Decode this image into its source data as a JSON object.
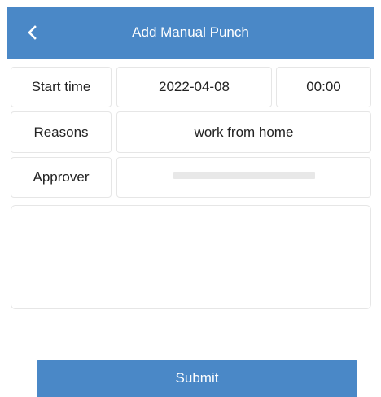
{
  "header": {
    "title": "Add Manual Punch",
    "back_icon": "chevron-left-icon",
    "background_color": "#4a88c7"
  },
  "form": {
    "start_time": {
      "label": "Start time",
      "date_value": "2022-04-08",
      "time_value": "00:00"
    },
    "reasons": {
      "label": "Reasons",
      "value": "work from home"
    },
    "approver": {
      "label": "Approver",
      "value": ""
    },
    "notes": {
      "value": "",
      "placeholder": ""
    }
  },
  "submit": {
    "label": "Submit",
    "color": "#4a88c7"
  }
}
